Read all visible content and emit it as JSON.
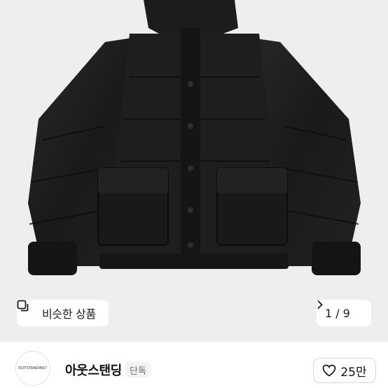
{
  "product_image": {
    "alt": "black puffer jacket",
    "background_color": "#eeeeef"
  },
  "similar_button": {
    "label": "비슷한 상품",
    "icon": "copy-icon"
  },
  "pager": {
    "current": "1",
    "separator": "/",
    "total": "9",
    "icon": "chevron-right-icon"
  },
  "seller": {
    "avatar_text": "OUTSTANDING°",
    "name": "아웃스탠딩",
    "badge": "단독"
  },
  "like_button": {
    "icon": "heart-icon",
    "count": "25만"
  }
}
